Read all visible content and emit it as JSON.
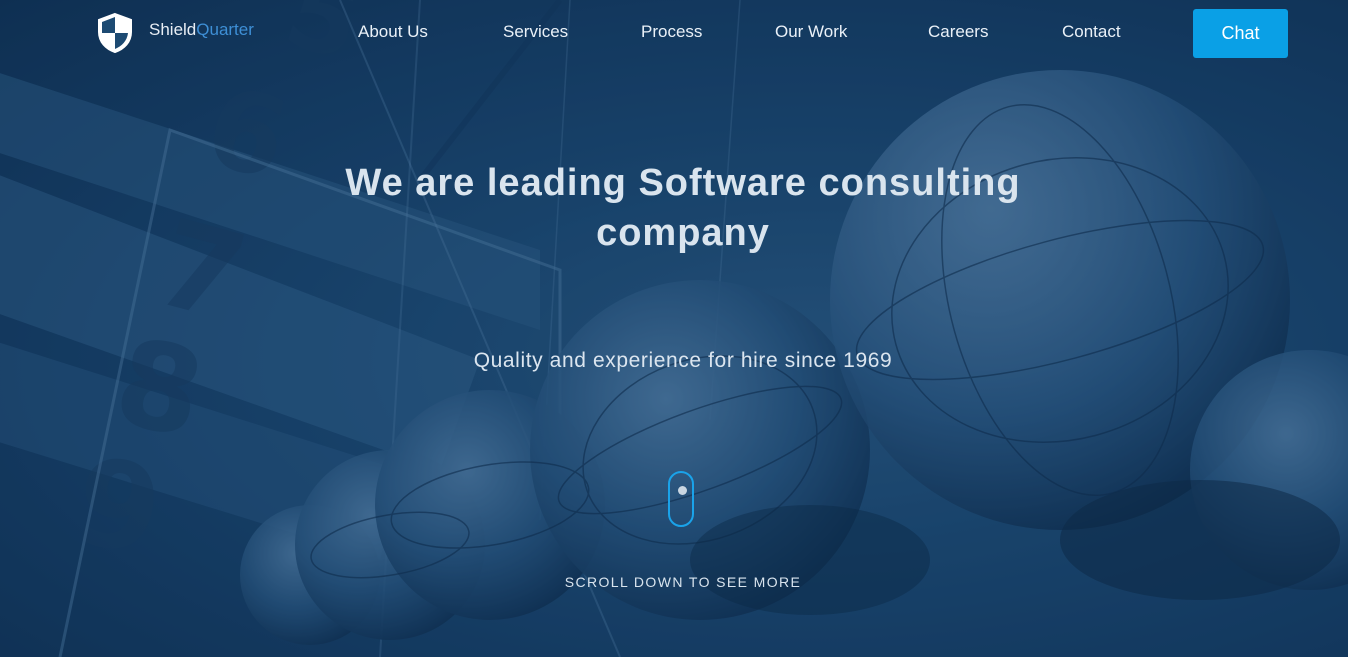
{
  "brand": {
    "name_part1": "Shield",
    "name_part2": "Quarter",
    "accent_color": "#3e8fd6"
  },
  "nav": {
    "items": [
      {
        "label": "About Us"
      },
      {
        "label": "Services"
      },
      {
        "label": "Process"
      },
      {
        "label": "Our Work"
      },
      {
        "label": "Careers"
      },
      {
        "label": "Contact"
      }
    ],
    "cta_label": "Chat",
    "cta_color": "#0aa0e6"
  },
  "hero": {
    "headline": "We are leading Software consulting company",
    "subheadline": "Quality and experience for hire since 1969",
    "scroll_label": "SCROLL DOWN TO SEE MORE",
    "scroll_icon": "mouse-scroll-icon"
  },
  "colors": {
    "background": "#1d4a72",
    "text": "#d9e4ee"
  }
}
